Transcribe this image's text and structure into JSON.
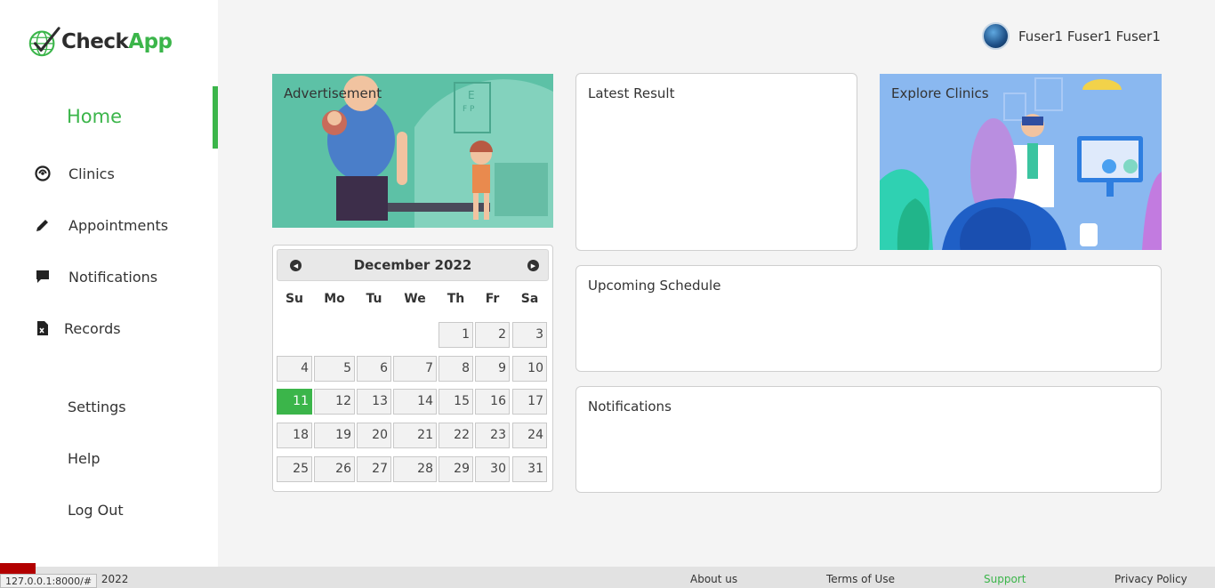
{
  "brand": {
    "part1": "Check",
    "part2": "App"
  },
  "nav": {
    "home": "Home",
    "items": [
      {
        "label": "Clinics",
        "icon": "clinics-icon"
      },
      {
        "label": "Appointments",
        "icon": "pencil-icon"
      },
      {
        "label": "Notifications",
        "icon": "chat-bubble-icon"
      },
      {
        "label": "Records",
        "icon": "document-icon"
      }
    ],
    "settings": "Settings",
    "help": "Help",
    "logout": "Log Out"
  },
  "user": {
    "name": "Fuser1 Fuser1 Fuser1"
  },
  "cards": {
    "advertisement": "Advertisement",
    "latest_result": "Latest Result",
    "explore_clinics": "Explore Clinics",
    "upcoming_schedule": "Upcoming Schedule",
    "notifications": "Notifications"
  },
  "calendar": {
    "title": "December 2022",
    "weekdays": [
      "Su",
      "Mo",
      "Tu",
      "We",
      "Th",
      "Fr",
      "Sa"
    ],
    "first_weekday_index": 4,
    "days_in_month": 31,
    "selected_day": 11
  },
  "footer": {
    "copyright": "© 2022",
    "about": "About us",
    "terms": "Terms of Use",
    "support": "Support",
    "privacy": "Privacy Policy"
  },
  "status_url": "127.0.0.1:8000/#",
  "colors": {
    "accent": "#3bb54a",
    "ad_bg": "#5dc1a6",
    "clinics_bg": "#8ab8f0"
  }
}
